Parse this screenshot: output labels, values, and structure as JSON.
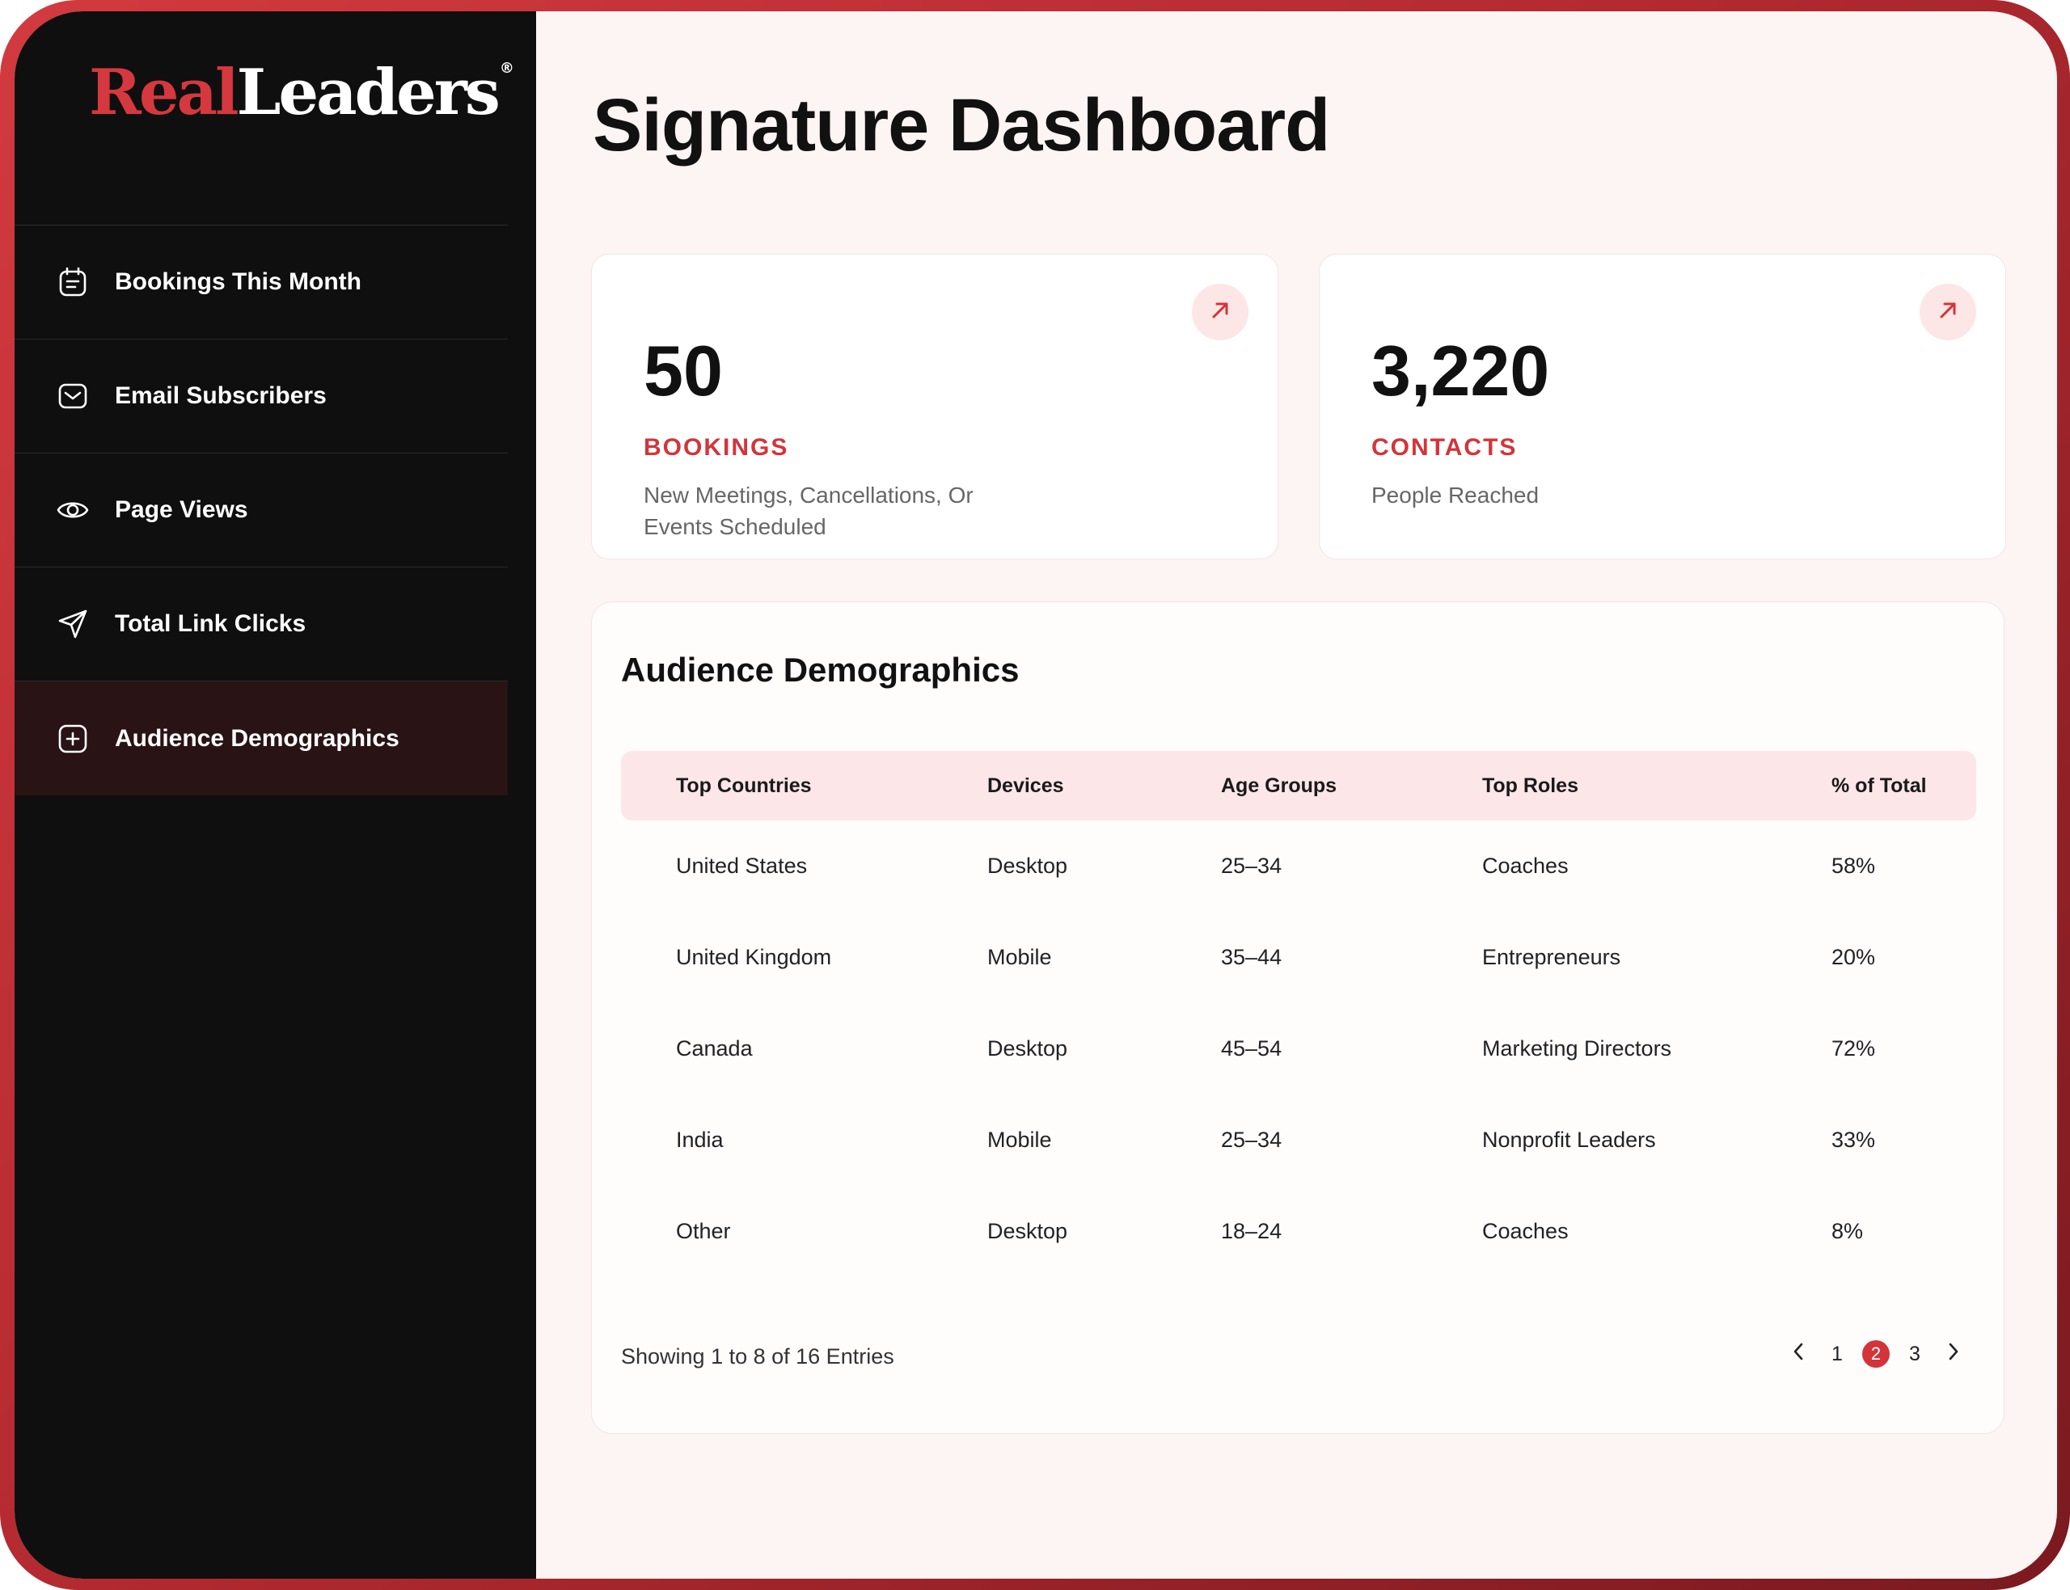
{
  "brand": {
    "part1": "Real",
    "part2": "Leaders",
    "mark": "®"
  },
  "colors": {
    "accent": "#d3343a",
    "sidebar_bg": "#0f0f0f",
    "active_bg": "#2a1314",
    "main_bg": "#fdf4f4",
    "header_row_bg": "#fce6e7"
  },
  "sidebar": {
    "items": [
      {
        "label": "Bookings This Month",
        "icon": "calendar-icon"
      },
      {
        "label": "Email Subscribers",
        "icon": "inbox-icon"
      },
      {
        "label": "Page Views",
        "icon": "eye-icon"
      },
      {
        "label": "Total Link Clicks",
        "icon": "send-icon"
      },
      {
        "label": "Audience Demographics",
        "icon": "plus-square-icon",
        "active": true
      }
    ]
  },
  "page": {
    "title": "Signature Dashboard"
  },
  "stats": [
    {
      "value": "50",
      "label": "BOOKINGS",
      "desc": "New Meetings, Cancellations, Or Events Scheduled",
      "icon": "arrow-up-right-icon"
    },
    {
      "value": "3,220",
      "label": "CONTACTS",
      "desc": "People Reached",
      "icon": "arrow-up-right-icon"
    }
  ],
  "demographics": {
    "title": "Audience Demographics",
    "columns": [
      "Top Countries",
      "Devices",
      "Age Groups",
      "Top Roles",
      "% of Total"
    ],
    "rows": [
      [
        "United States",
        "Desktop",
        "25–34",
        "Coaches",
        "58%"
      ],
      [
        "United Kingdom",
        "Mobile",
        "35–44",
        "Entrepreneurs",
        "20%"
      ],
      [
        "Canada",
        "Desktop",
        "45–54",
        "Marketing Directors",
        "72%"
      ],
      [
        "India",
        "Mobile",
        "25–34",
        "Nonprofit Leaders",
        "33%"
      ],
      [
        "Other",
        "Desktop",
        "18–24",
        "Coaches",
        "8%"
      ]
    ],
    "showing": "Showing 1 to 8 of 16 Entries",
    "pagination": {
      "prev_icon": "chevron-left-icon",
      "next_icon": "chevron-right-icon",
      "pages": [
        "1",
        "2",
        "3"
      ],
      "current": "2"
    }
  }
}
